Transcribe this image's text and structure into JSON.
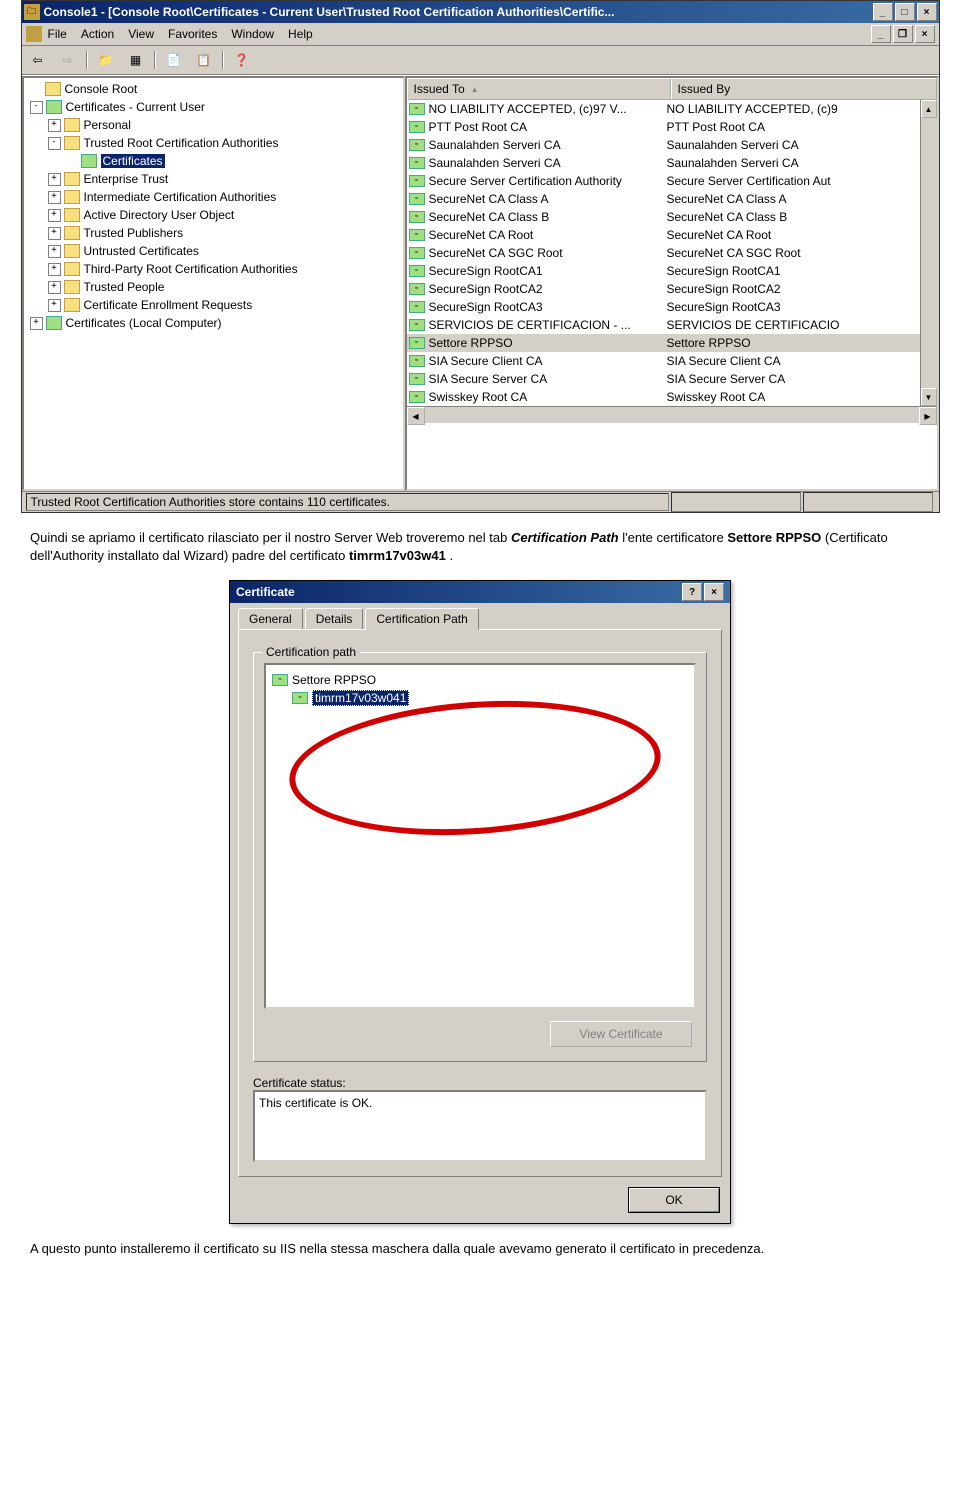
{
  "mmc": {
    "title": "Console1 - [Console Root\\Certificates - Current User\\Trusted Root Certification Authorities\\Certific...",
    "menus": [
      "File",
      "Action",
      "View",
      "Favorites",
      "Window",
      "Help"
    ],
    "toolbar_icons": [
      "back-arrow-icon",
      "forward-arrow-icon",
      "up-folder-icon",
      "show-hide-tree-icon",
      "",
      "refresh-icon",
      "export-list-icon",
      "",
      "help-icon"
    ],
    "tree": [
      {
        "indent": 0,
        "exp": "",
        "icon": "folder",
        "label": "Console Root",
        "sel": false
      },
      {
        "indent": 0,
        "exp": "-",
        "icon": "cert",
        "label": "Certificates - Current User",
        "sel": false
      },
      {
        "indent": 1,
        "exp": "+",
        "icon": "folder",
        "label": "Personal",
        "sel": false
      },
      {
        "indent": 1,
        "exp": "-",
        "icon": "folder",
        "label": "Trusted Root Certification Authorities",
        "sel": false
      },
      {
        "indent": 2,
        "exp": "",
        "icon": "cert",
        "label": "Certificates",
        "sel": true
      },
      {
        "indent": 1,
        "exp": "+",
        "icon": "folder",
        "label": "Enterprise Trust",
        "sel": false
      },
      {
        "indent": 1,
        "exp": "+",
        "icon": "folder",
        "label": "Intermediate Certification Authorities",
        "sel": false
      },
      {
        "indent": 1,
        "exp": "+",
        "icon": "folder",
        "label": "Active Directory User Object",
        "sel": false
      },
      {
        "indent": 1,
        "exp": "+",
        "icon": "folder",
        "label": "Trusted Publishers",
        "sel": false
      },
      {
        "indent": 1,
        "exp": "+",
        "icon": "folder",
        "label": "Untrusted Certificates",
        "sel": false
      },
      {
        "indent": 1,
        "exp": "+",
        "icon": "folder",
        "label": "Third-Party Root Certification Authorities",
        "sel": false
      },
      {
        "indent": 1,
        "exp": "+",
        "icon": "folder",
        "label": "Trusted People",
        "sel": false
      },
      {
        "indent": 1,
        "exp": "+",
        "icon": "folder",
        "label": "Certificate Enrollment Requests",
        "sel": false
      },
      {
        "indent": 0,
        "exp": "+",
        "icon": "cert",
        "label": "Certificates (Local Computer)",
        "sel": false
      }
    ],
    "list_headers": {
      "c1": "Issued To",
      "c2": "Issued By"
    },
    "certificates": [
      {
        "to": "NO LIABILITY ACCEPTED, (c)97 V...",
        "by": "NO LIABILITY ACCEPTED, (c)9",
        "sel": false
      },
      {
        "to": "PTT Post Root CA",
        "by": "PTT Post Root CA",
        "sel": false
      },
      {
        "to": "Saunalahden Serveri CA",
        "by": "Saunalahden Serveri CA",
        "sel": false
      },
      {
        "to": "Saunalahden Serveri CA",
        "by": "Saunalahden Serveri CA",
        "sel": false
      },
      {
        "to": "Secure Server Certification Authority",
        "by": "Secure Server Certification Aut",
        "sel": false
      },
      {
        "to": "SecureNet CA Class A",
        "by": "SecureNet CA Class A",
        "sel": false
      },
      {
        "to": "SecureNet CA Class B",
        "by": "SecureNet CA Class B",
        "sel": false
      },
      {
        "to": "SecureNet CA Root",
        "by": "SecureNet CA Root",
        "sel": false
      },
      {
        "to": "SecureNet CA SGC Root",
        "by": "SecureNet CA SGC Root",
        "sel": false
      },
      {
        "to": "SecureSign RootCA1",
        "by": "SecureSign RootCA1",
        "sel": false
      },
      {
        "to": "SecureSign RootCA2",
        "by": "SecureSign RootCA2",
        "sel": false
      },
      {
        "to": "SecureSign RootCA3",
        "by": "SecureSign RootCA3",
        "sel": false
      },
      {
        "to": "SERVICIOS DE CERTIFICACION - ...",
        "by": "SERVICIOS DE CERTIFICACIO",
        "sel": false
      },
      {
        "to": "Settore RPPSO",
        "by": "Settore RPPSO",
        "sel": true
      },
      {
        "to": "SIA Secure Client CA",
        "by": "SIA Secure Client CA",
        "sel": false
      },
      {
        "to": "SIA Secure Server CA",
        "by": "SIA Secure Server CA",
        "sel": false
      },
      {
        "to": "Swisskey Root CA",
        "by": "Swisskey Root CA",
        "sel": false
      }
    ],
    "statusbar": "Trusted Root Certification Authorities store contains 110 certificates."
  },
  "para1": {
    "t1": "Quindi se apriamo il certificato rilasciato per il nostro Server Web troveremo nel tab ",
    "b1": "Certification Path",
    "t2": " l'ente certificatore ",
    "b2": "Settore RPPSO",
    "t3": " (Certificato dell'Authority installato dal Wizard) padre del certificato ",
    "b3": "timrm17v03w41",
    "t4": "."
  },
  "cert_dialog": {
    "title": "Certificate",
    "tabs": [
      "General",
      "Details",
      "Certification Path"
    ],
    "active_tab": 2,
    "group_title": "Certification path",
    "path": [
      {
        "indent": 0,
        "label": "Settore RPPSO",
        "sel": false
      },
      {
        "indent": 1,
        "label": "timrm17v03w041",
        "sel": true
      }
    ],
    "view_cert_btn": "View Certificate",
    "status_label": "Certificate status:",
    "status_text": "This certificate is OK.",
    "ok_btn": "OK"
  },
  "para2": "A questo punto installeremo il certificato su IIS nella stessa maschera dalla quale avevamo generato il certificato in precedenza."
}
